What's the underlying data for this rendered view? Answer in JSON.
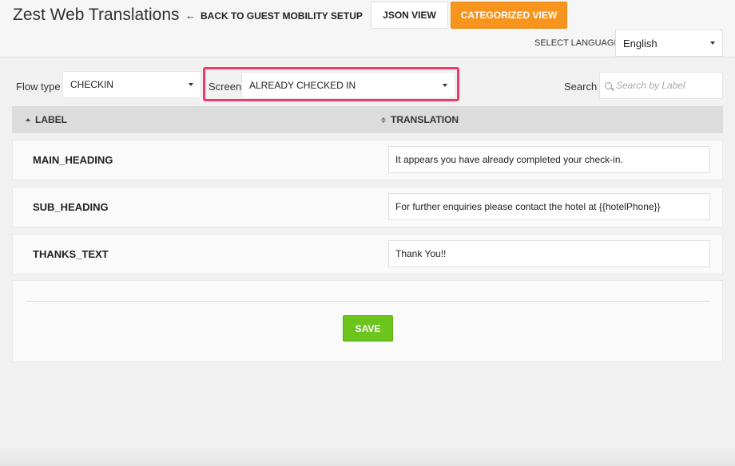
{
  "header": {
    "app_title": "Zest Web Translations",
    "back_link": "BACK TO GUEST MOBILITY SETUP",
    "json_view": "JSON VIEW",
    "categorized_view": "CATEGORIZED VIEW",
    "select_language_label": "SELECT LANGUAGE",
    "language": "English"
  },
  "filters": {
    "flow_type_label": "Flow type",
    "flow_type": "CHECKIN",
    "screen_label": "Screen",
    "screen": "ALREADY CHECKED IN",
    "search_label": "Search",
    "search_placeholder": "Search by Label"
  },
  "table": {
    "col_label": "LABEL",
    "col_translation": "TRANSLATION",
    "rows": [
      {
        "label": "MAIN_HEADING",
        "translation": "It appears you have already completed your check-in."
      },
      {
        "label": "SUB_HEADING",
        "translation": "For further enquiries please contact the hotel at {{hotelPhone}}"
      },
      {
        "label": "THANKS_TEXT",
        "translation": "Thank You!!"
      }
    ]
  },
  "save_label": "SAVE",
  "colors": {
    "accent_orange": "#f7941d",
    "save_green": "#6cc51c",
    "highlight_pink": "#f0386b"
  }
}
